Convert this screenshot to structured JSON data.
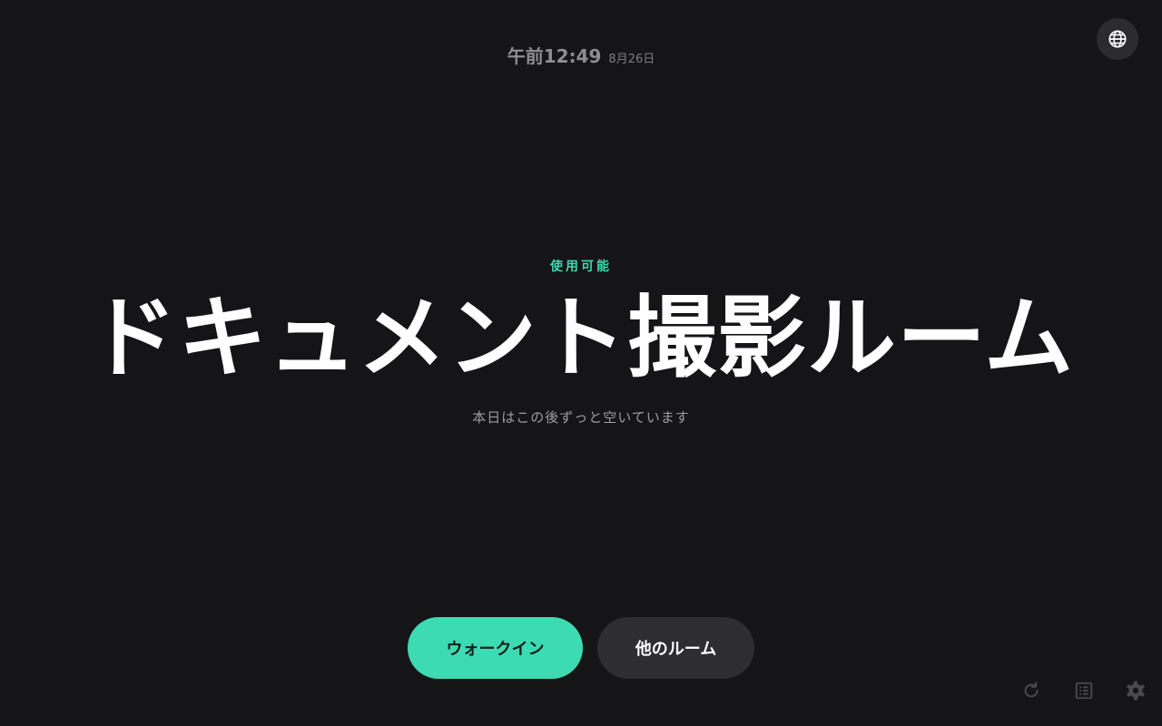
{
  "header": {
    "time": "午前12:49",
    "date": "8月26日",
    "language_icon": "globe-icon"
  },
  "room": {
    "status": "使用可能",
    "name": "ドキュメント撮影ルーム",
    "availability": "本日はこの後ずっと空いています"
  },
  "actions": {
    "walk_in_label": "ウォークイン",
    "other_rooms_label": "他のルーム"
  },
  "footer_icons": [
    "refresh-icon",
    "list-icon",
    "settings-icon"
  ],
  "colors": {
    "background": "#151517",
    "accent": "#3ddbb2",
    "secondary_button": "#2e2e31",
    "title": "#ffffff"
  }
}
